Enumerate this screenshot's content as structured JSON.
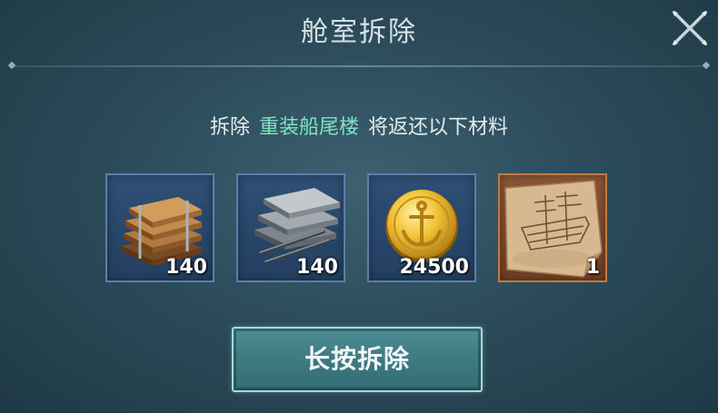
{
  "dialog": {
    "title": "舱室拆除",
    "close_icon": "close-x-icon"
  },
  "message": {
    "prefix": "拆除",
    "item_name": "重装船尾楼",
    "suffix": "将返还以下材料",
    "highlight_color": "#7fe2c4"
  },
  "materials": [
    {
      "icon": "wood-planks-icon",
      "count": "140",
      "rarity_color": "#5b7eab"
    },
    {
      "icon": "iron-plates-icon",
      "count": "140",
      "rarity_color": "#5b7eab"
    },
    {
      "icon": "gold-anchor-coin-icon",
      "count": "24500",
      "rarity_color": "#5b7eab"
    },
    {
      "icon": "ship-blueprint-icon",
      "count": "1",
      "rarity_color": "#c27a42"
    }
  ],
  "actions": {
    "dismantle_label": "长按拆除"
  }
}
